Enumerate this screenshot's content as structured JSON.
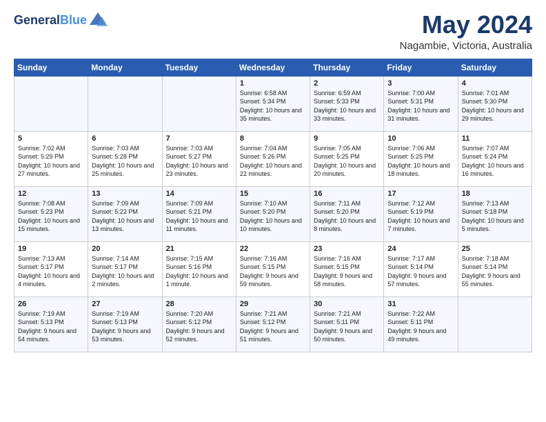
{
  "logo": {
    "line1": "General",
    "line2": "Blue"
  },
  "title": "May 2024",
  "location": "Nagambie, Victoria, Australia",
  "days_header": [
    "Sunday",
    "Monday",
    "Tuesday",
    "Wednesday",
    "Thursday",
    "Friday",
    "Saturday"
  ],
  "weeks": [
    [
      {
        "day": "",
        "sunrise": "",
        "sunset": "",
        "daylight": ""
      },
      {
        "day": "",
        "sunrise": "",
        "sunset": "",
        "daylight": ""
      },
      {
        "day": "",
        "sunrise": "",
        "sunset": "",
        "daylight": ""
      },
      {
        "day": "1",
        "sunrise": "Sunrise: 6:58 AM",
        "sunset": "Sunset: 5:34 PM",
        "daylight": "Daylight: 10 hours and 35 minutes."
      },
      {
        "day": "2",
        "sunrise": "Sunrise: 6:59 AM",
        "sunset": "Sunset: 5:33 PM",
        "daylight": "Daylight: 10 hours and 33 minutes."
      },
      {
        "day": "3",
        "sunrise": "Sunrise: 7:00 AM",
        "sunset": "Sunset: 5:31 PM",
        "daylight": "Daylight: 10 hours and 31 minutes."
      },
      {
        "day": "4",
        "sunrise": "Sunrise: 7:01 AM",
        "sunset": "Sunset: 5:30 PM",
        "daylight": "Daylight: 10 hours and 29 minutes."
      }
    ],
    [
      {
        "day": "5",
        "sunrise": "Sunrise: 7:02 AM",
        "sunset": "Sunset: 5:29 PM",
        "daylight": "Daylight: 10 hours and 27 minutes."
      },
      {
        "day": "6",
        "sunrise": "Sunrise: 7:03 AM",
        "sunset": "Sunset: 5:28 PM",
        "daylight": "Daylight: 10 hours and 25 minutes."
      },
      {
        "day": "7",
        "sunrise": "Sunrise: 7:03 AM",
        "sunset": "Sunset: 5:27 PM",
        "daylight": "Daylight: 10 hours and 23 minutes."
      },
      {
        "day": "8",
        "sunrise": "Sunrise: 7:04 AM",
        "sunset": "Sunset: 5:26 PM",
        "daylight": "Daylight: 10 hours and 22 minutes."
      },
      {
        "day": "9",
        "sunrise": "Sunrise: 7:05 AM",
        "sunset": "Sunset: 5:25 PM",
        "daylight": "Daylight: 10 hours and 20 minutes."
      },
      {
        "day": "10",
        "sunrise": "Sunrise: 7:06 AM",
        "sunset": "Sunset: 5:25 PM",
        "daylight": "Daylight: 10 hours and 18 minutes."
      },
      {
        "day": "11",
        "sunrise": "Sunrise: 7:07 AM",
        "sunset": "Sunset: 5:24 PM",
        "daylight": "Daylight: 10 hours and 16 minutes."
      }
    ],
    [
      {
        "day": "12",
        "sunrise": "Sunrise: 7:08 AM",
        "sunset": "Sunset: 5:23 PM",
        "daylight": "Daylight: 10 hours and 15 minutes."
      },
      {
        "day": "13",
        "sunrise": "Sunrise: 7:09 AM",
        "sunset": "Sunset: 5:22 PM",
        "daylight": "Daylight: 10 hours and 13 minutes."
      },
      {
        "day": "14",
        "sunrise": "Sunrise: 7:09 AM",
        "sunset": "Sunset: 5:21 PM",
        "daylight": "Daylight: 10 hours and 11 minutes."
      },
      {
        "day": "15",
        "sunrise": "Sunrise: 7:10 AM",
        "sunset": "Sunset: 5:20 PM",
        "daylight": "Daylight: 10 hours and 10 minutes."
      },
      {
        "day": "16",
        "sunrise": "Sunrise: 7:11 AM",
        "sunset": "Sunset: 5:20 PM",
        "daylight": "Daylight: 10 hours and 8 minutes."
      },
      {
        "day": "17",
        "sunrise": "Sunrise: 7:12 AM",
        "sunset": "Sunset: 5:19 PM",
        "daylight": "Daylight: 10 hours and 7 minutes."
      },
      {
        "day": "18",
        "sunrise": "Sunrise: 7:13 AM",
        "sunset": "Sunset: 5:18 PM",
        "daylight": "Daylight: 10 hours and 5 minutes."
      }
    ],
    [
      {
        "day": "19",
        "sunrise": "Sunrise: 7:13 AM",
        "sunset": "Sunset: 5:17 PM",
        "daylight": "Daylight: 10 hours and 4 minutes."
      },
      {
        "day": "20",
        "sunrise": "Sunrise: 7:14 AM",
        "sunset": "Sunset: 5:17 PM",
        "daylight": "Daylight: 10 hours and 2 minutes."
      },
      {
        "day": "21",
        "sunrise": "Sunrise: 7:15 AM",
        "sunset": "Sunset: 5:16 PM",
        "daylight": "Daylight: 10 hours and 1 minute."
      },
      {
        "day": "22",
        "sunrise": "Sunrise: 7:16 AM",
        "sunset": "Sunset: 5:15 PM",
        "daylight": "Daylight: 9 hours and 59 minutes."
      },
      {
        "day": "23",
        "sunrise": "Sunrise: 7:16 AM",
        "sunset": "Sunset: 5:15 PM",
        "daylight": "Daylight: 9 hours and 58 minutes."
      },
      {
        "day": "24",
        "sunrise": "Sunrise: 7:17 AM",
        "sunset": "Sunset: 5:14 PM",
        "daylight": "Daylight: 9 hours and 57 minutes."
      },
      {
        "day": "25",
        "sunrise": "Sunrise: 7:18 AM",
        "sunset": "Sunset: 5:14 PM",
        "daylight": "Daylight: 9 hours and 55 minutes."
      }
    ],
    [
      {
        "day": "26",
        "sunrise": "Sunrise: 7:19 AM",
        "sunset": "Sunset: 5:13 PM",
        "daylight": "Daylight: 9 hours and 54 minutes."
      },
      {
        "day": "27",
        "sunrise": "Sunrise: 7:19 AM",
        "sunset": "Sunset: 5:13 PM",
        "daylight": "Daylight: 9 hours and 53 minutes."
      },
      {
        "day": "28",
        "sunrise": "Sunrise: 7:20 AM",
        "sunset": "Sunset: 5:12 PM",
        "daylight": "Daylight: 9 hours and 52 minutes."
      },
      {
        "day": "29",
        "sunrise": "Sunrise: 7:21 AM",
        "sunset": "Sunset: 5:12 PM",
        "daylight": "Daylight: 9 hours and 51 minutes."
      },
      {
        "day": "30",
        "sunrise": "Sunrise: 7:21 AM",
        "sunset": "Sunset: 5:11 PM",
        "daylight": "Daylight: 9 hours and 50 minutes."
      },
      {
        "day": "31",
        "sunrise": "Sunrise: 7:22 AM",
        "sunset": "Sunset: 5:11 PM",
        "daylight": "Daylight: 9 hours and 49 minutes."
      },
      {
        "day": "",
        "sunrise": "",
        "sunset": "",
        "daylight": ""
      }
    ]
  ]
}
